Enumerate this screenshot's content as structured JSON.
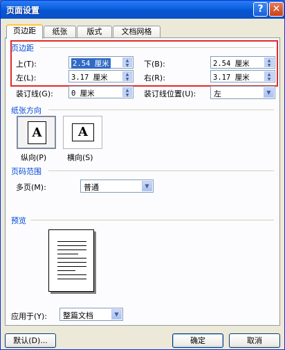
{
  "window": {
    "title": "页面设置",
    "help_glyph": "?",
    "close_glyph": "✕"
  },
  "tabs": [
    {
      "label": "页边距",
      "active": true
    },
    {
      "label": "纸张",
      "active": false
    },
    {
      "label": "版式",
      "active": false
    },
    {
      "label": "文档网格",
      "active": false
    }
  ],
  "margins": {
    "group_label": "页边距",
    "top_label": "上(T):",
    "top_value": "2.54 厘米",
    "bottom_label": "下(B):",
    "bottom_value": "2.54 厘米",
    "left_label": "左(L):",
    "left_value": "3.17 厘米",
    "right_label": "右(R):",
    "right_value": "3.17 厘米",
    "gutter_label": "装订线(G):",
    "gutter_value": "0 厘米",
    "gutter_pos_label": "装订线位置(U):",
    "gutter_pos_value": "左"
  },
  "orientation": {
    "group_label": "纸张方向",
    "icon_glyph": "A",
    "portrait_label": "纵向(P)",
    "landscape_label": "横向(S)",
    "selected": "portrait"
  },
  "pages": {
    "group_label": "页码范围",
    "multiple_label": "多页(M):",
    "multiple_value": "普通"
  },
  "preview": {
    "group_label": "预览",
    "apply_label": "应用于(Y):",
    "apply_value": "整篇文档"
  },
  "buttons": {
    "default": "默认(D)...",
    "ok": "确定",
    "cancel": "取消"
  },
  "colors": {
    "accent": "#0046d5",
    "highlight_box": "#e02929",
    "title_bar": "#0a5fde"
  }
}
